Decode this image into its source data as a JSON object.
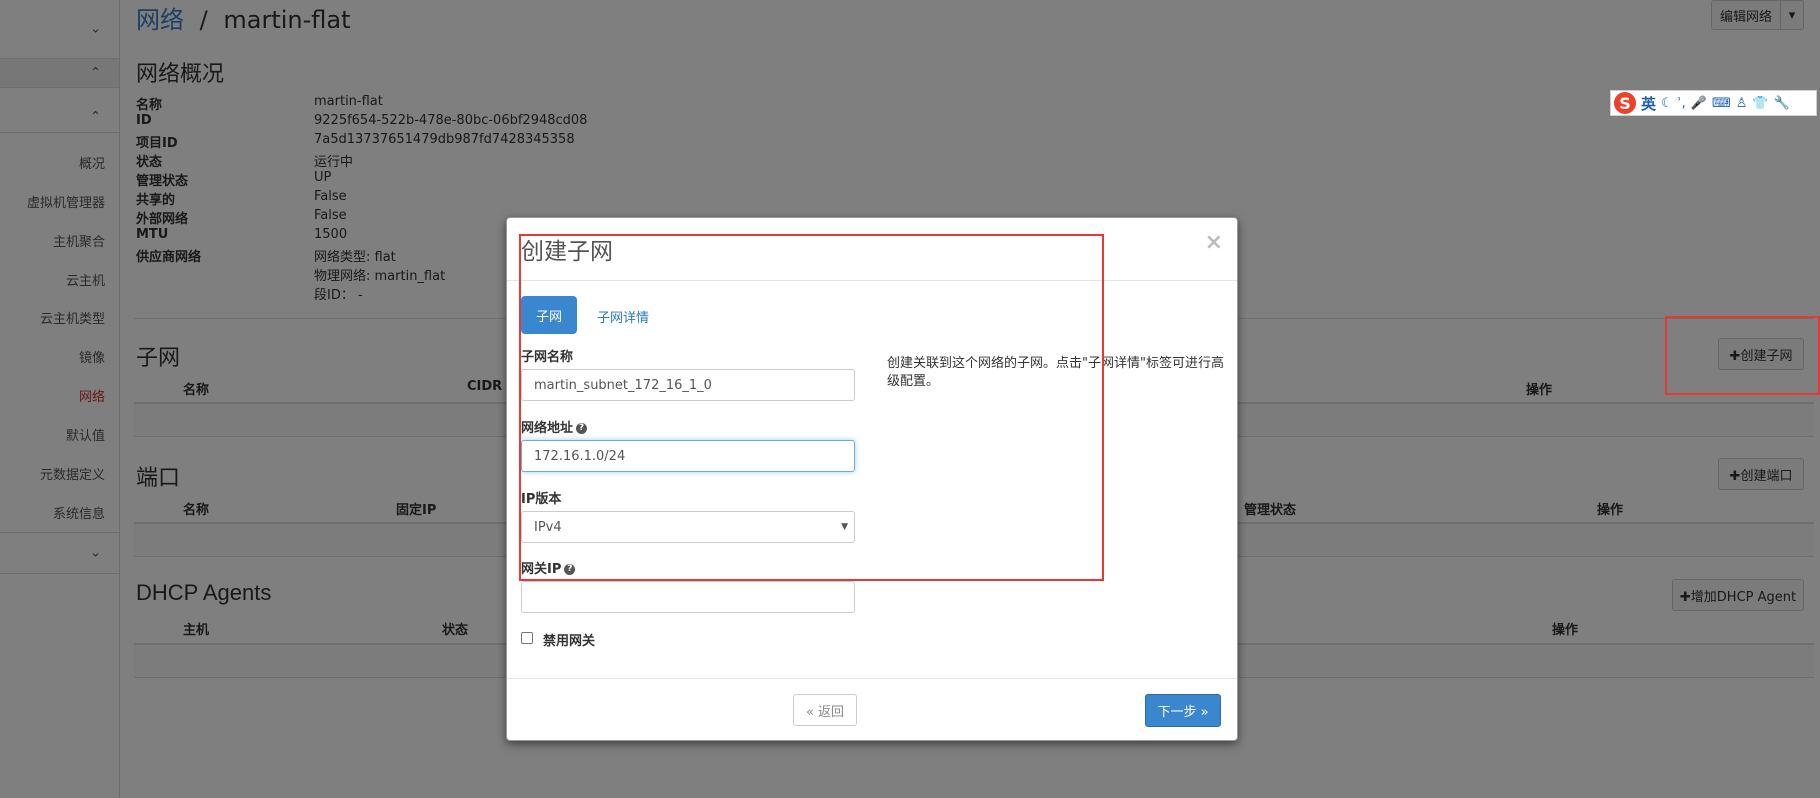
{
  "breadcrumb": {
    "parent": "网络",
    "separator": "/",
    "current": "martin-flat"
  },
  "header_actions": {
    "edit_network": "编辑网络",
    "caret": "▾"
  },
  "sidebar": {
    "chevron_icons": [
      "⌄",
      "⌃",
      "⌃",
      "⌄"
    ],
    "items": [
      {
        "label": "概况"
      },
      {
        "label": "虚拟机管理器"
      },
      {
        "label": "主机聚合"
      },
      {
        "label": "云主机"
      },
      {
        "label": "云主机类型"
      },
      {
        "label": "镜像"
      },
      {
        "label": "网络",
        "active": true
      },
      {
        "label": "默认值"
      },
      {
        "label": "元数据定义"
      },
      {
        "label": "系统信息"
      }
    ]
  },
  "overview": {
    "title": "网络概况",
    "rows": [
      {
        "key": "名称",
        "value": "martin-flat"
      },
      {
        "key": "ID",
        "value": "9225f654-522b-478e-80bc-06bf2948cd08"
      },
      {
        "key": "项目ID",
        "value": "7a5d13737651479db987fd7428345358"
      },
      {
        "key": "状态",
        "value": "运行中"
      },
      {
        "key": "管理状态",
        "value": "UP"
      },
      {
        "key": "共享的",
        "value": "False"
      },
      {
        "key": "外部网络",
        "value": "False"
      },
      {
        "key": "MTU",
        "value": "1500"
      },
      {
        "key": "供应商网络",
        "value": "网络类型: flat"
      },
      {
        "key": "",
        "value": "物理网络: martin_flat"
      },
      {
        "key": "",
        "value": "段ID： -"
      }
    ]
  },
  "subnets": {
    "title": "子网",
    "create_button": "✚创建子网",
    "columns": {
      "name": "名称",
      "cidr": "CIDR",
      "actions": "操作"
    }
  },
  "ports": {
    "title": "端口",
    "create_button": "✚创建端口",
    "columns": {
      "name": "名称",
      "fixed_ip": "固定IP",
      "admin_state": "管理状态",
      "actions": "操作"
    }
  },
  "dhcp": {
    "title": "DHCP Agents",
    "add_button": "✚增加DHCP Agent",
    "columns": {
      "host": "主机",
      "status": "状态",
      "actions": "操作"
    }
  },
  "ime_toolbar": {
    "logo": "S",
    "lang": "英",
    "icons": [
      "☾",
      "ʾ,",
      "🎤",
      "⌨",
      "♙",
      "👕",
      "🔧"
    ]
  },
  "modal": {
    "title": "创建子网",
    "close": "×",
    "tabs": [
      {
        "label": "子网",
        "active": true
      },
      {
        "label": "子网详情",
        "active": false
      }
    ],
    "fields": {
      "subnet_name": {
        "label": "子网名称",
        "value": "martin_subnet_172_16_1_0"
      },
      "network_address": {
        "label": "网络地址",
        "help_icon": "?",
        "value": "172.16.1.0/24"
      },
      "ip_version": {
        "label": "IP版本",
        "value": "IPv4",
        "arrow": "▼"
      },
      "gateway_ip": {
        "label": "网关IP",
        "help_icon": "?",
        "value": ""
      },
      "disable_gateway": {
        "label": "禁用网关",
        "checked": false
      }
    },
    "help_text": "创建关联到这个网络的子网。点击\"子网详情\"标签可进行高级配置。",
    "buttons": {
      "back": "« 返回",
      "next": "下一步 »"
    }
  },
  "colors": {
    "primary": "#3b87cf",
    "link": "#3a7fc3",
    "active_nav": "#c9302c",
    "annotation_red": "#e53935",
    "overlay": "rgba(0,0,0,0.5)"
  }
}
